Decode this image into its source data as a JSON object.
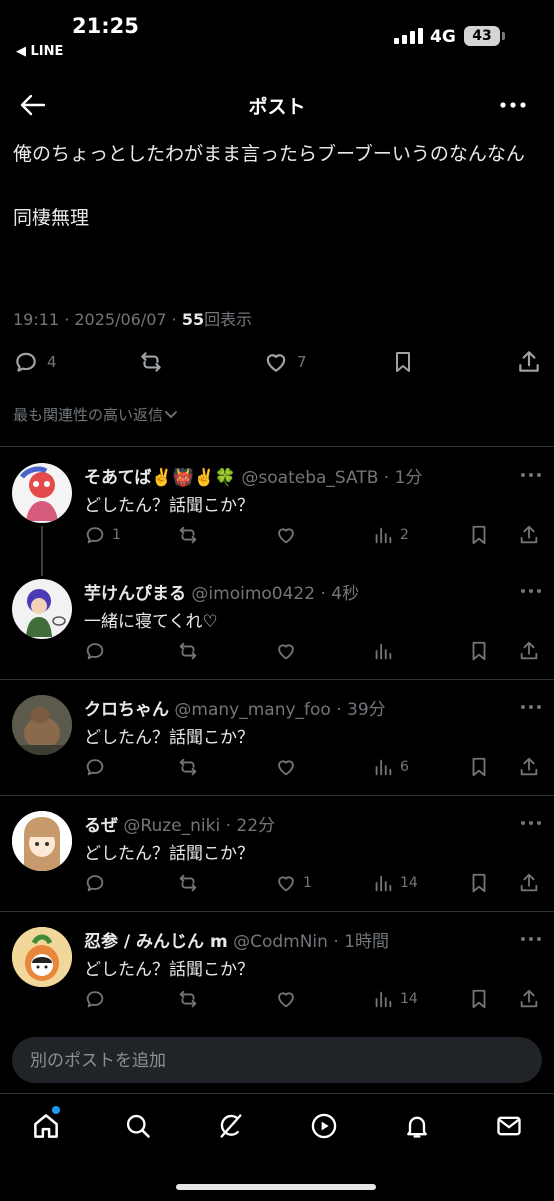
{
  "status_bar": {
    "time": "21:25",
    "back_app": "◀ LINE",
    "network": "4G",
    "battery": "43"
  },
  "header": {
    "title": "ポスト"
  },
  "post": {
    "line1": "俺のちょっとしたわがまま言ったらブーブーいうのなんなん",
    "line2": "同棲無理",
    "meta_prefix": "19:11 · 2025/06/07 · ",
    "views": "55",
    "views_suffix": "回表示",
    "replies": "4",
    "likes": "7"
  },
  "sort_label": "最も関連性の高い返信",
  "replies": [
    {
      "name": "そあてば✌️👹✌️🍀",
      "handle": "@soateba_SATB",
      "time": "· 1分",
      "text": "どしたん？話聞こか？",
      "replies": "1",
      "likes": "",
      "views": "2"
    },
    {
      "name": "芋けんぴまる",
      "handle": "@imoimo0422",
      "time": "· 4秒",
      "text": "一緒に寝てくれ♡",
      "replies": "",
      "likes": "",
      "views": ""
    },
    {
      "name": "クロちゃん",
      "handle": "@many_many_foo",
      "time": "· 39分",
      "text": "どしたん？話聞こか？",
      "replies": "",
      "likes": "",
      "views": "6"
    },
    {
      "name": "るぜ",
      "handle": "@Ruze_niki",
      "time": "· 22分",
      "text": "どしたん？話聞こか？",
      "replies": "",
      "likes": "1",
      "views": "14"
    },
    {
      "name": "忍参 / みんじん m",
      "handle": "@CodmNin",
      "time": "· 1時間",
      "text": "どしたん？話聞こか？",
      "replies": "",
      "likes": "",
      "views": "14"
    }
  ],
  "compose": {
    "placeholder": "別のポストを追加"
  },
  "icons": {
    "back": "back-arrow-icon",
    "more": "more-icon",
    "reply": "reply-icon",
    "retweet": "retweet-icon",
    "like": "heart-icon",
    "bookmark": "bookmark-icon",
    "share": "share-icon",
    "views": "views-icon",
    "nav": [
      "home-icon",
      "search-icon",
      "grok-icon",
      "video-icon",
      "bell-icon",
      "mail-icon"
    ]
  },
  "colors": {
    "background": "#000000",
    "text": "#e7e9ea",
    "muted": "#71767b",
    "accent": "#1d9bf0"
  }
}
